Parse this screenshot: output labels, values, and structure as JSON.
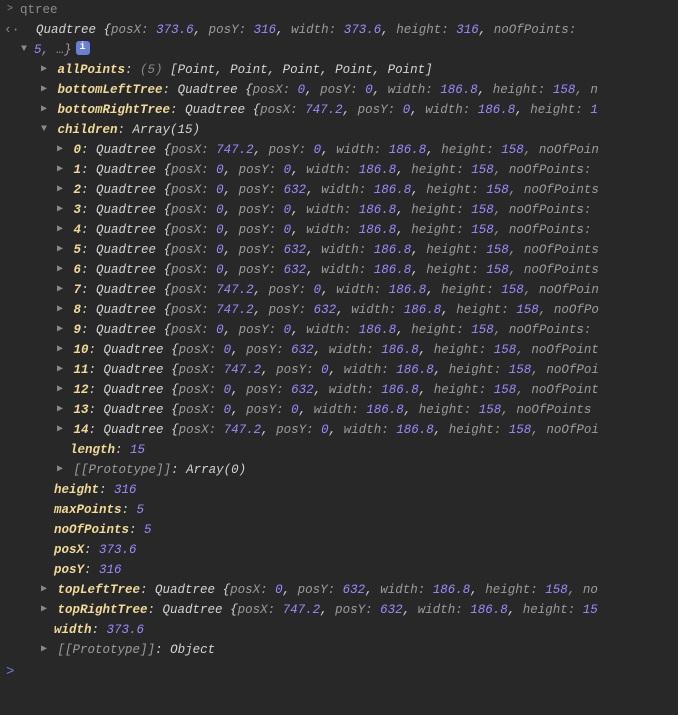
{
  "header": {
    "root_label": "qtree"
  },
  "summary": {
    "class": "Quadtree",
    "posX": "373.6",
    "posY": "316",
    "width": "373.6",
    "height": "316",
    "trail": "noOfPoints:",
    "line2_prefix": "5",
    "line2_ellipsis": ", …}",
    "info": "i"
  },
  "allPoints": {
    "key": "allPoints",
    "count": "(5)",
    "items_preview": "[Point, Point, Point, Point, Point]"
  },
  "bottomLeftTree": {
    "key": "bottomLeftTree",
    "class": "Quadtree",
    "posX": "0",
    "posY": "0",
    "width": "186.8",
    "height": "158",
    "trail": ", n"
  },
  "bottomRightTree": {
    "key": "bottomRightTree",
    "class": "Quadtree",
    "posX": "747.2",
    "posY": "0",
    "width": "186.8",
    "height": "1",
    "trail": ""
  },
  "children_key": "children",
  "children_type": "Array(15)",
  "children": [
    {
      "idx": "0",
      "posX": "747.2",
      "posY": "0",
      "width": "186.8",
      "height": "158",
      "trail": ", noOfPoin"
    },
    {
      "idx": "1",
      "posX": "0",
      "posY": "0",
      "width": "186.8",
      "height": "158",
      "trail": ", noOfPoints:"
    },
    {
      "idx": "2",
      "posX": "0",
      "posY": "632",
      "width": "186.8",
      "height": "158",
      "trail": ", noOfPoints"
    },
    {
      "idx": "3",
      "posX": "0",
      "posY": "0",
      "width": "186.8",
      "height": "158",
      "trail": ", noOfPoints:"
    },
    {
      "idx": "4",
      "posX": "0",
      "posY": "0",
      "width": "186.8",
      "height": "158",
      "trail": ", noOfPoints:"
    },
    {
      "idx": "5",
      "posX": "0",
      "posY": "632",
      "width": "186.8",
      "height": "158",
      "trail": ", noOfPoints"
    },
    {
      "idx": "6",
      "posX": "0",
      "posY": "632",
      "width": "186.8",
      "height": "158",
      "trail": ", noOfPoints"
    },
    {
      "idx": "7",
      "posX": "747.2",
      "posY": "0",
      "width": "186.8",
      "height": "158",
      "trail": ", noOfPoin"
    },
    {
      "idx": "8",
      "posX": "747.2",
      "posY": "632",
      "width": "186.8",
      "height": "158",
      "trail": ", noOfPo"
    },
    {
      "idx": "9",
      "posX": "0",
      "posY": "0",
      "width": "186.8",
      "height": "158",
      "trail": ", noOfPoints:"
    },
    {
      "idx": "10",
      "posX": "0",
      "posY": "632",
      "width": "186.8",
      "height": "158",
      "trail": ", noOfPoint"
    },
    {
      "idx": "11",
      "posX": "747.2",
      "posY": "0",
      "width": "186.8",
      "height": "158",
      "trail": ", noOfPoi"
    },
    {
      "idx": "12",
      "posX": "0",
      "posY": "632",
      "width": "186.8",
      "height": "158",
      "trail": ", noOfPoint"
    },
    {
      "idx": "13",
      "posX": "0",
      "posY": "0",
      "width": "186.8",
      "height": "158",
      "trail": ", noOfPoints"
    },
    {
      "idx": "14",
      "posX": "747.2",
      "posY": "0",
      "width": "186.8",
      "height": "158",
      "trail": ", noOfPoi"
    }
  ],
  "length": {
    "key": "length",
    "value": "15"
  },
  "proto_arr": {
    "key": "[[Prototype]]",
    "value": "Array(0)"
  },
  "simpleProps": {
    "height": {
      "key": "height",
      "value": "316"
    },
    "maxPoints": {
      "key": "maxPoints",
      "value": "5"
    },
    "noOfPoints": {
      "key": "noOfPoints",
      "value": "5"
    },
    "posX": {
      "key": "posX",
      "value": "373.6"
    },
    "posY": {
      "key": "posY",
      "value": "316"
    }
  },
  "topLeftTree": {
    "key": "topLeftTree",
    "class": "Quadtree",
    "posX": "0",
    "posY": "632",
    "width": "186.8",
    "height": "158",
    "trail": ", no"
  },
  "topRightTree": {
    "key": "topRightTree",
    "class": "Quadtree",
    "posX": "747.2",
    "posY": "632",
    "width": "186.8",
    "height": "15",
    "trail": ""
  },
  "widthProp": {
    "key": "width",
    "value": "373.6"
  },
  "proto_obj": {
    "key": "[[Prototype]]",
    "value": "Object"
  },
  "kw": {
    "posX": "posX:",
    "posY": "posY:",
    "width": "width:",
    "height": "height:",
    "open": " {",
    "comma": ", "
  }
}
